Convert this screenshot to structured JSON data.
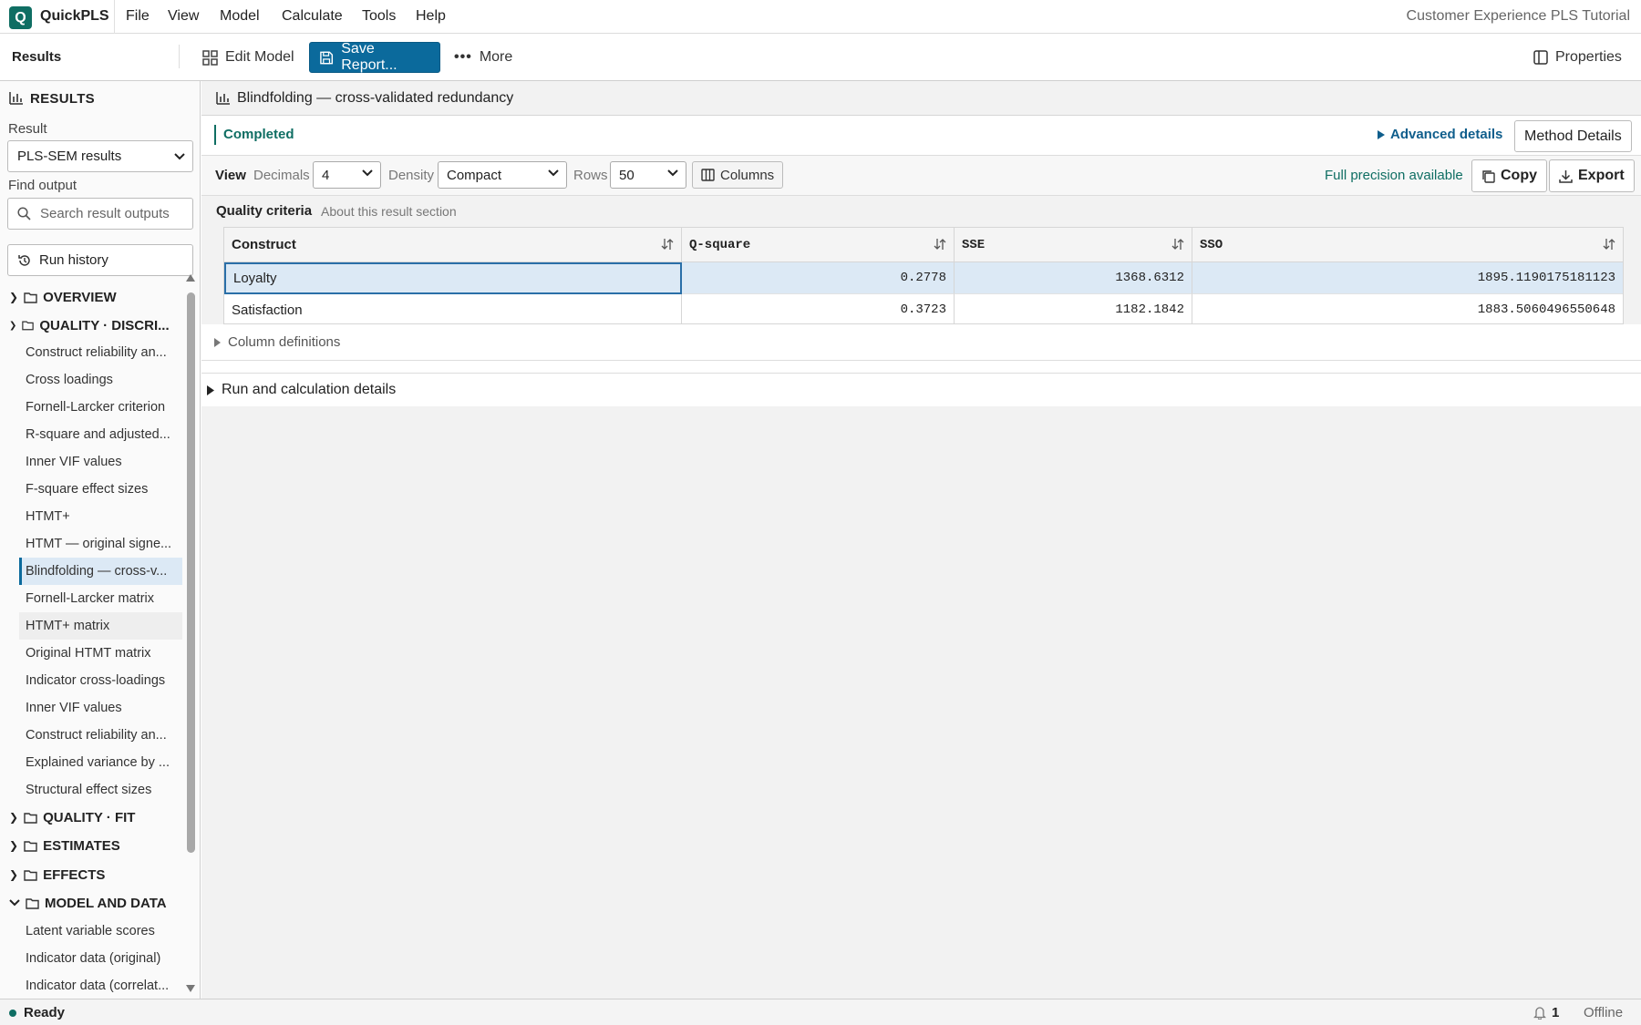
{
  "app": {
    "logo_letter": "Q",
    "name": "QuickPLS",
    "document_title": "Customer Experience PLS Tutorial"
  },
  "menu": {
    "items": [
      "File",
      "View",
      "Model",
      "Calculate",
      "Tools",
      "Help"
    ]
  },
  "toolbar": {
    "section": "Results",
    "edit_model": "Edit Model",
    "save_report": "Save Report...",
    "more": "More",
    "properties": "Properties"
  },
  "sidebar": {
    "header": "RESULTS",
    "result_label": "Result",
    "result_value": "PLS-SEM results",
    "find_label": "Find output",
    "search_placeholder": "Search result outputs",
    "run_history": "Run history",
    "categories": {
      "overview": "OVERVIEW",
      "quality_disc": "QUALITY · DISCRI...",
      "quality_fit": "QUALITY · FIT",
      "estimates": "ESTIMATES",
      "effects": "EFFECTS",
      "model_data": "MODEL AND DATA"
    },
    "quality_items": [
      "Construct reliability an...",
      "Cross loadings",
      "Fornell-Larcker criterion",
      "R-square and adjusted...",
      "Inner VIF values",
      "F-square effect sizes",
      "HTMT+",
      "HTMT — original signe...",
      "Blindfolding — cross-v...",
      "Fornell-Larcker matrix",
      "HTMT+ matrix",
      "Original HTMT matrix",
      "Indicator cross-loadings",
      "Inner VIF values",
      "Construct reliability an...",
      "Explained variance by ...",
      "Structural effect sizes"
    ],
    "model_items": [
      "Latent variable scores",
      "Indicator data (original)",
      "Indicator data (correlat..."
    ]
  },
  "main": {
    "title": "Blindfolding — cross-validated redundancy",
    "status": "Completed",
    "advanced_details": "Advanced details",
    "method_details": "Method Details",
    "view_label": "View",
    "decimals_label": "Decimals",
    "decimals_value": "4",
    "density_label": "Density",
    "density_value": "Compact",
    "rows_label": "Rows",
    "rows_value": "50",
    "columns_btn": "Columns",
    "full_precision": "Full precision available",
    "copy": "Copy",
    "export": "Export",
    "section_title": "Quality criteria",
    "section_about": "About this result section",
    "table": {
      "headers": [
        "Construct",
        "Q-square",
        "SSE",
        "SSO"
      ],
      "rows": [
        [
          "Loyalty",
          "0.2778",
          "1368.6312",
          "1895.1190175181123"
        ],
        [
          "Satisfaction",
          "0.3723",
          "1182.1842",
          "1883.5060496550648"
        ]
      ]
    },
    "column_definitions": "Column definitions",
    "run_details": "Run and calculation details"
  },
  "statusbar": {
    "ready": "Ready",
    "notifications": "1",
    "connection": "Offline"
  },
  "colors": {
    "brand": "#0f6e63",
    "primary_button": "#0b6a9c",
    "selection": "#dce9f5"
  }
}
